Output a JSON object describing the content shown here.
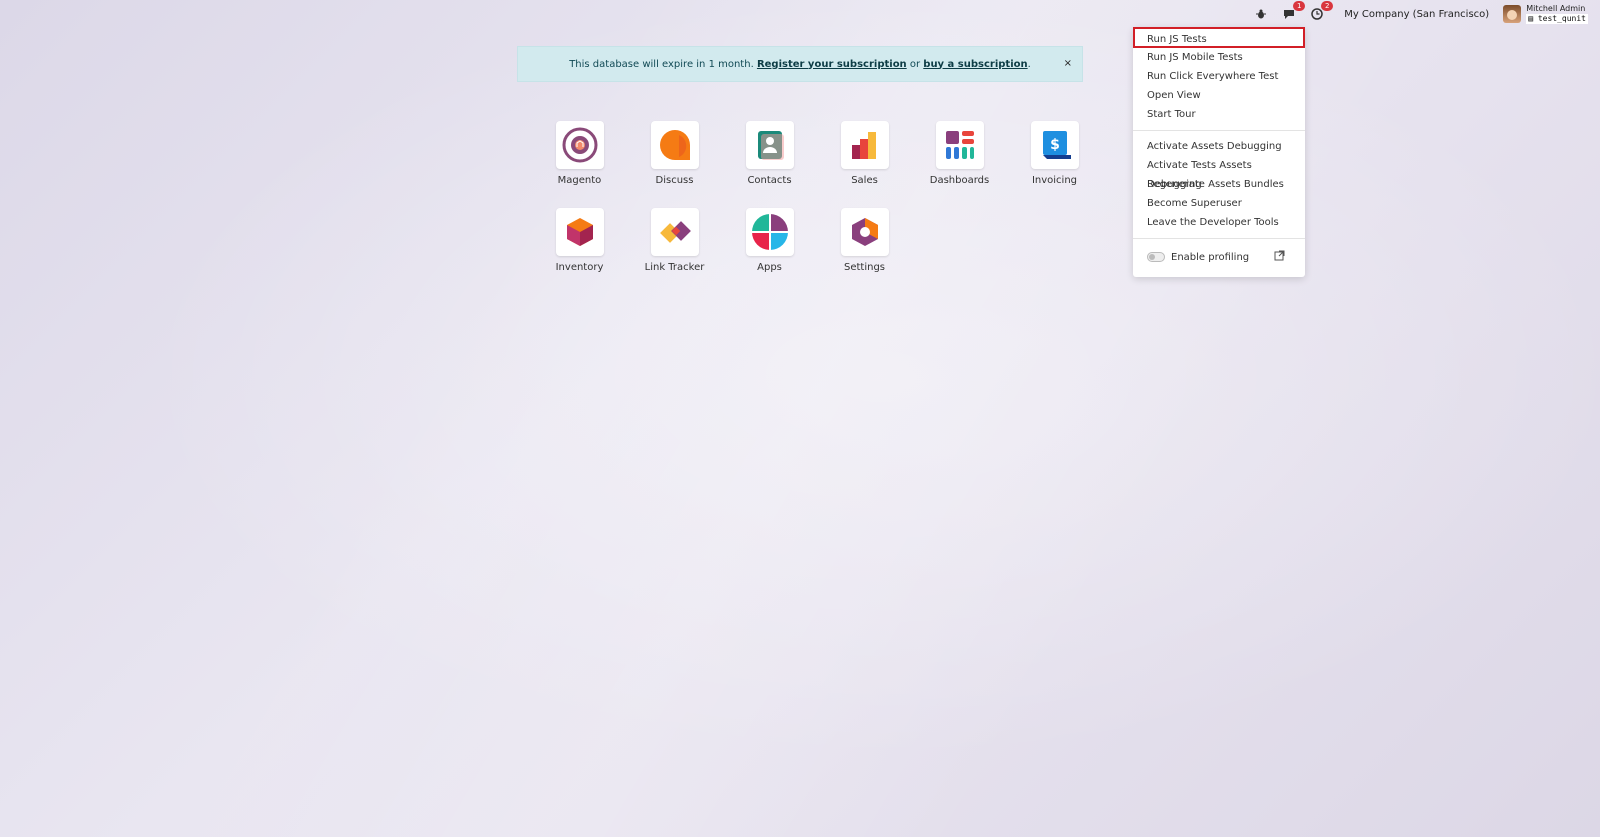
{
  "topbar": {
    "chat_badge": "1",
    "activity_badge": "2",
    "company": "My Company (San Francisco)",
    "user_name": "Mitchell Admin",
    "db_name": "test_qunit"
  },
  "banner": {
    "text_before": "This database will expire in 1 month. ",
    "register_link": "Register your subscription",
    "text_middle": " or ",
    "buy_link": "buy a subscription",
    "text_after": ".",
    "close": "×"
  },
  "apps": [
    {
      "label": "Magento",
      "icon": "magento-icon"
    },
    {
      "label": "Discuss",
      "icon": "discuss-icon"
    },
    {
      "label": "Contacts",
      "icon": "contacts-icon"
    },
    {
      "label": "Sales",
      "icon": "sales-icon"
    },
    {
      "label": "Dashboards",
      "icon": "dashboards-icon"
    },
    {
      "label": "Invoicing",
      "icon": "invoicing-icon"
    },
    {
      "label": "Inventory",
      "icon": "inventory-icon"
    },
    {
      "label": "Link Tracker",
      "icon": "link-tracker-icon"
    },
    {
      "label": "Apps",
      "icon": "apps-icon"
    },
    {
      "label": "Settings",
      "icon": "settings-icon"
    }
  ],
  "dev_menu": {
    "group1": [
      "Run JS Tests",
      "Run JS Mobile Tests",
      "Run Click Everywhere Test",
      "Open View",
      "Start Tour"
    ],
    "group2": [
      "Activate Assets Debugging",
      "Activate Tests Assets Debugging",
      "Regenerate Assets Bundles",
      "Become Superuser",
      "Leave the Developer Tools"
    ],
    "profiling_label": "Enable profiling"
  },
  "colors": {
    "highlight": "#d21f27",
    "badge": "#d9363e",
    "banner_bg": "#d2eaee"
  }
}
